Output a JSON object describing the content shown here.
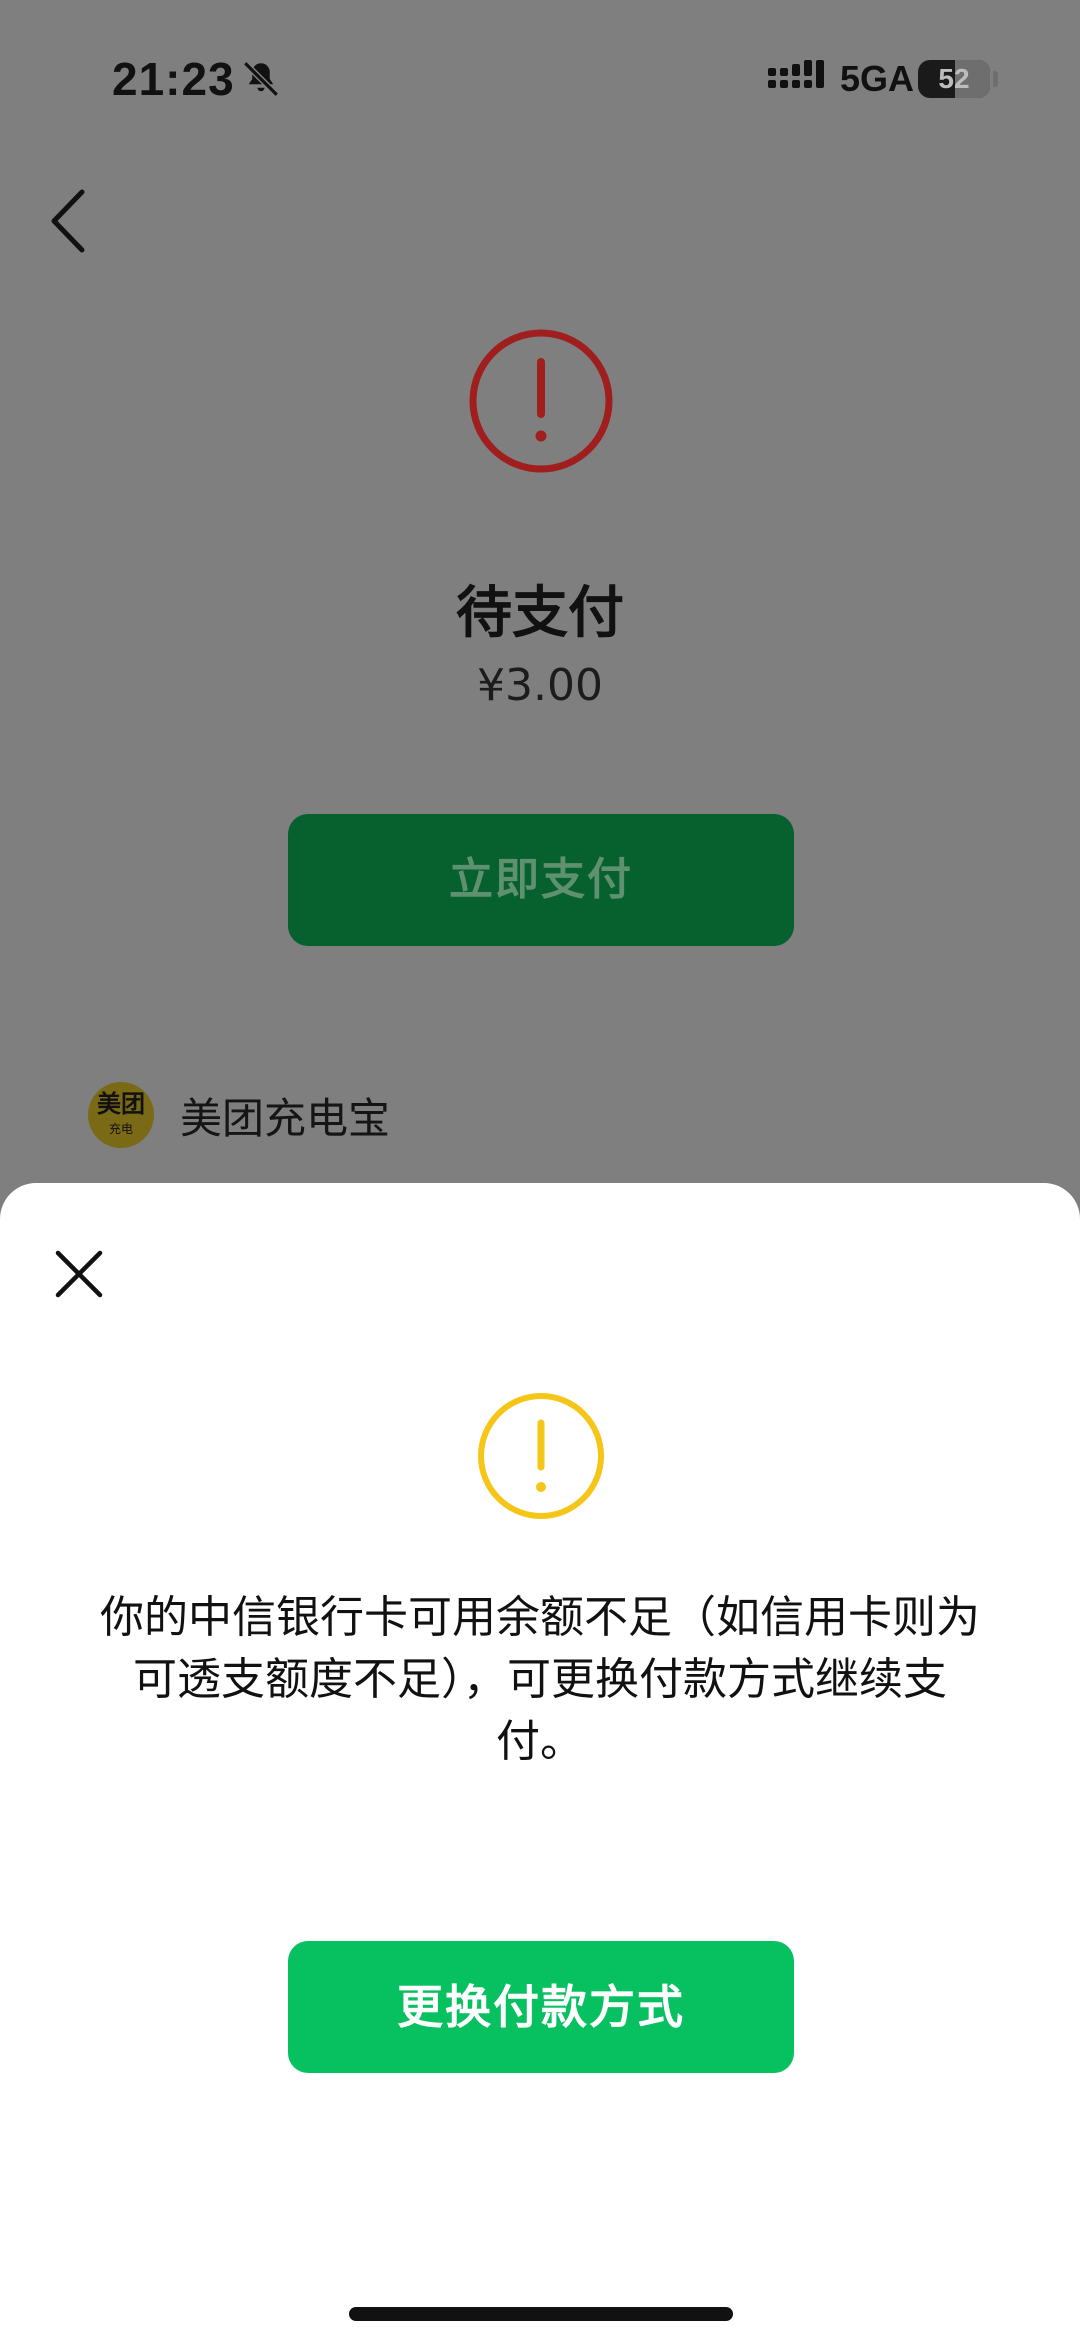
{
  "status_bar": {
    "time": "21:23",
    "network": "5GA",
    "battery_level": "52",
    "battery_percent": 52,
    "icons": [
      "mute-bell-icon",
      "signal-icon"
    ]
  },
  "order": {
    "status_title": "待支付",
    "amount": "¥3.00",
    "pay_button_label": "立即支付",
    "status_icon": "exclamation-circle-icon",
    "status_icon_color": "#a01e1e"
  },
  "merchant": {
    "logo_main_text": "美团",
    "logo_sub_text": "充电",
    "name": "美团充电宝"
  },
  "dialog": {
    "message_lines": [
      "你的中信银行卡可用余额不足（如信用卡则为",
      "可透支额度不足），可更换付款方式继续支",
      "付。"
    ],
    "button_label": "更换付款方式",
    "warning_icon": "exclamation-circle-icon",
    "warning_color": "#f5c518",
    "accent_color": "#07c160"
  }
}
